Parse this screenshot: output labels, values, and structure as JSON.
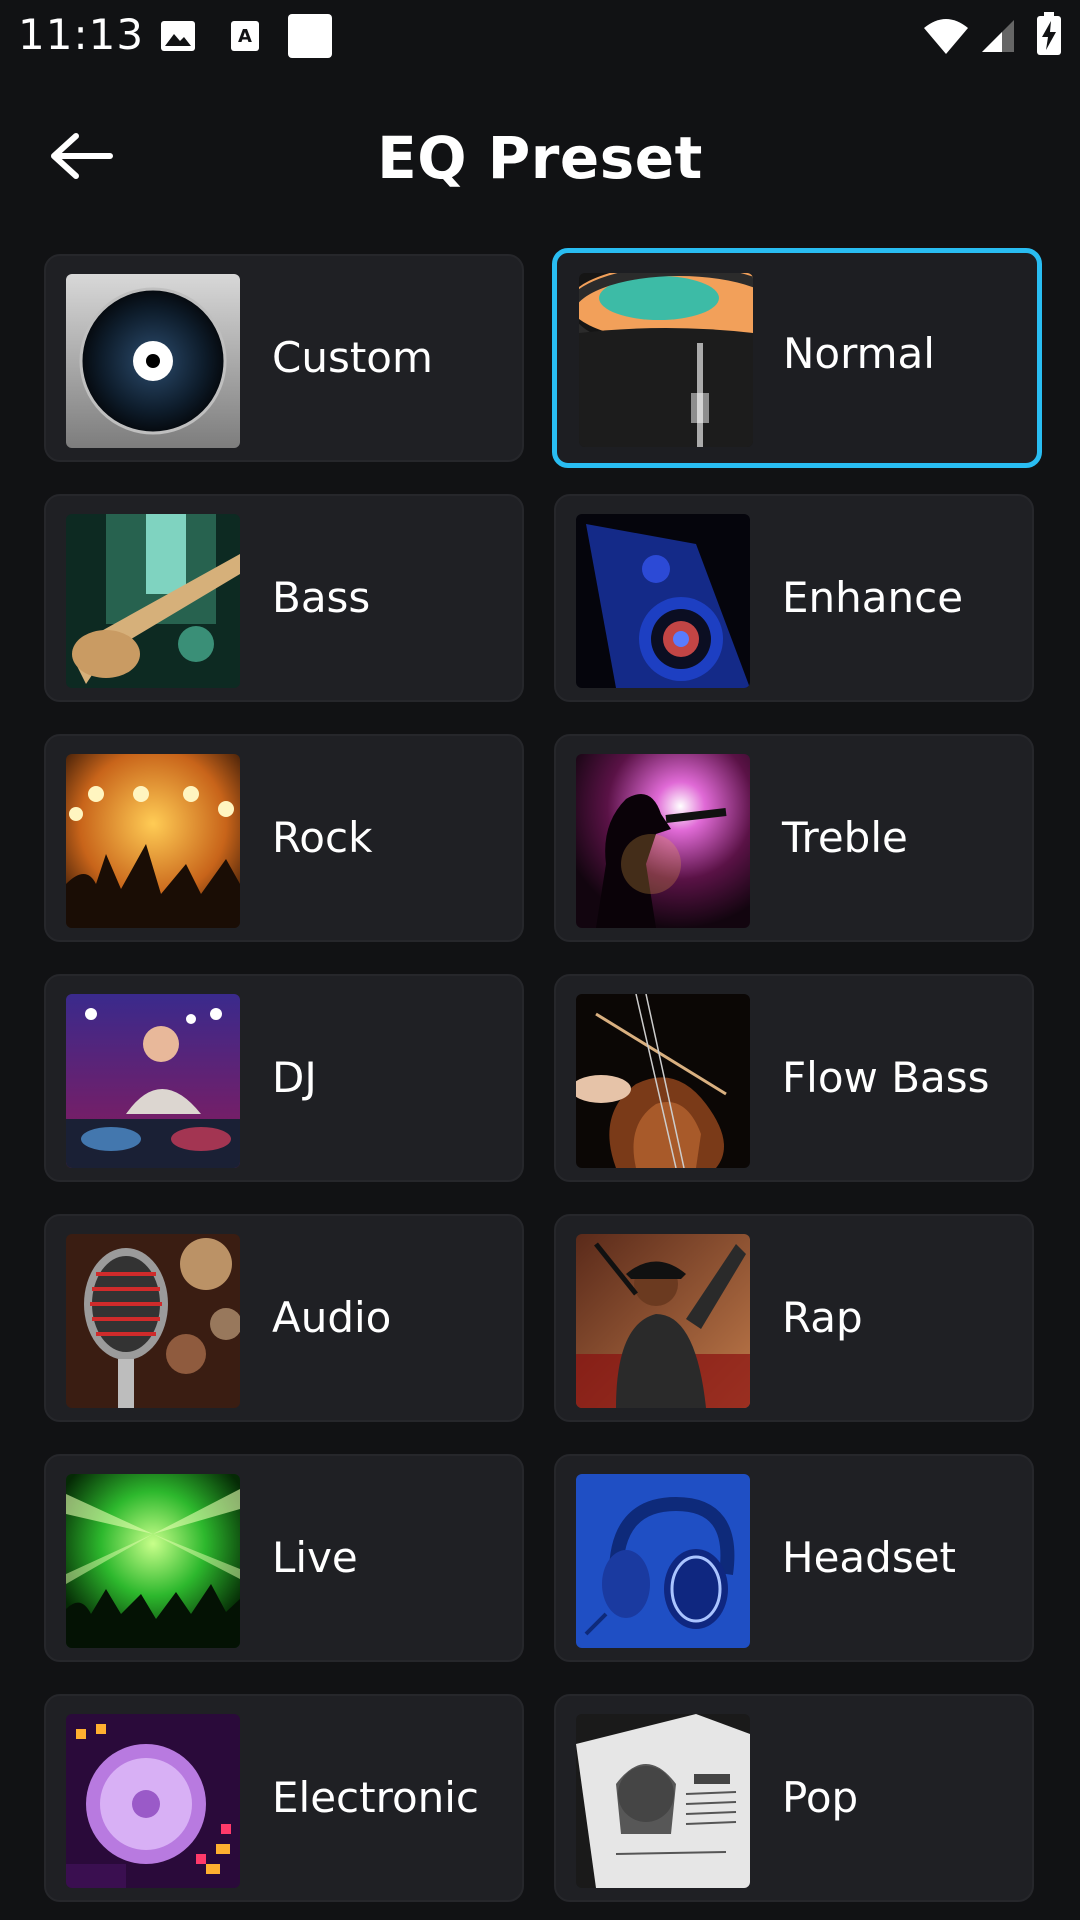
{
  "status_bar": {
    "time": "11:13",
    "icons": [
      "gallery-icon",
      "font-icon",
      "square-icon",
      "wifi-icon",
      "signal-icon",
      "battery-icon"
    ]
  },
  "header": {
    "title": "EQ Preset",
    "back_icon": "arrow-left-icon"
  },
  "accent_color": "#29bdf2",
  "selected_preset": "Normal",
  "presets": [
    {
      "label": "Custom",
      "image": "vinyl-disc"
    },
    {
      "label": "Normal",
      "image": "turntable-record"
    },
    {
      "label": "Bass",
      "image": "bass-guitar"
    },
    {
      "label": "Enhance",
      "image": "speaker"
    },
    {
      "label": "Rock",
      "image": "concert-crowd"
    },
    {
      "label": "Treble",
      "image": "singer-silhouette"
    },
    {
      "label": "DJ",
      "image": "dj-deck"
    },
    {
      "label": "Flow Bass",
      "image": "cello"
    },
    {
      "label": "Audio",
      "image": "microphone"
    },
    {
      "label": "Rap",
      "image": "rapper"
    },
    {
      "label": "Live",
      "image": "green-lasers"
    },
    {
      "label": "Headset",
      "image": "headphones"
    },
    {
      "label": "Electronic",
      "image": "dj-controller"
    },
    {
      "label": "Pop",
      "image": "magazine"
    }
  ]
}
